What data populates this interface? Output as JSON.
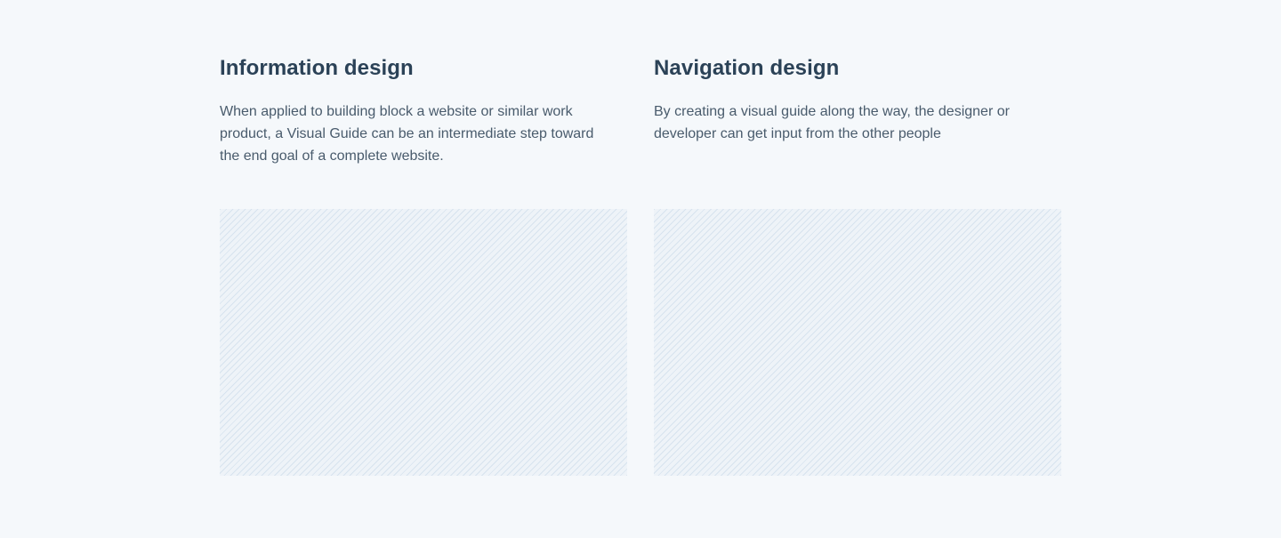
{
  "features": [
    {
      "title": "Information design",
      "description": "When applied to building block a website or similar work product, a Visual Guide can be an intermediate step toward the end goal of a complete website."
    },
    {
      "title": "Navigation design",
      "description": "By creating a visual guide along the way, the designer or developer can get input from the other people"
    }
  ],
  "colors": {
    "background": "#f5f8fb",
    "heading": "#2b4257",
    "body_text": "#495b6c",
    "placeholder_fill": "#eef3f8",
    "placeholder_stripe": "#c4d6e6"
  }
}
